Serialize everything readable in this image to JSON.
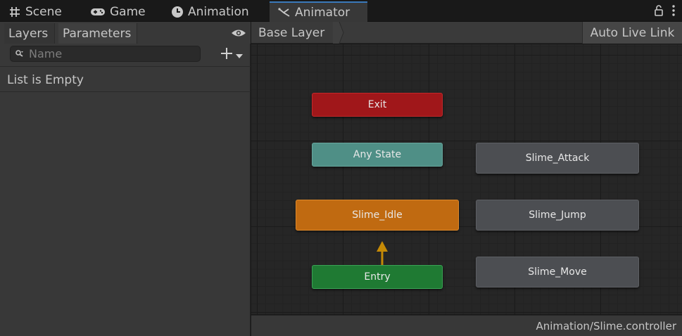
{
  "tabs": [
    {
      "label": "Scene",
      "icon": "grid-icon",
      "active": false
    },
    {
      "label": "Game",
      "icon": "gamepad-icon",
      "active": false
    },
    {
      "label": "Animation",
      "icon": "clock-icon",
      "active": false
    },
    {
      "label": "Animator",
      "icon": "animator-icon",
      "active": true
    }
  ],
  "left_panel": {
    "tabs": {
      "layers": "Layers",
      "parameters": "Parameters"
    },
    "search_placeholder": "Name",
    "empty_text": "List is Empty"
  },
  "animator": {
    "breadcrumb": "Base Layer",
    "live_link_label": "Auto Live Link",
    "states": {
      "exit": "Exit",
      "any_state": "Any State",
      "idle": "Slime_Idle",
      "entry": "Entry",
      "attack": "Slime_Attack",
      "jump": "Slime_Jump",
      "move": "Slime_Move"
    },
    "status_path": "Animation/Slime.controller"
  },
  "colors": {
    "exit": "#a0171a",
    "any_state": "#4f8f86",
    "default_state": "#c06a11",
    "entry": "#1f7a33",
    "state": "#4c4e52",
    "transition": "#c58a06",
    "active_tab_accent": "#3a79bb"
  }
}
